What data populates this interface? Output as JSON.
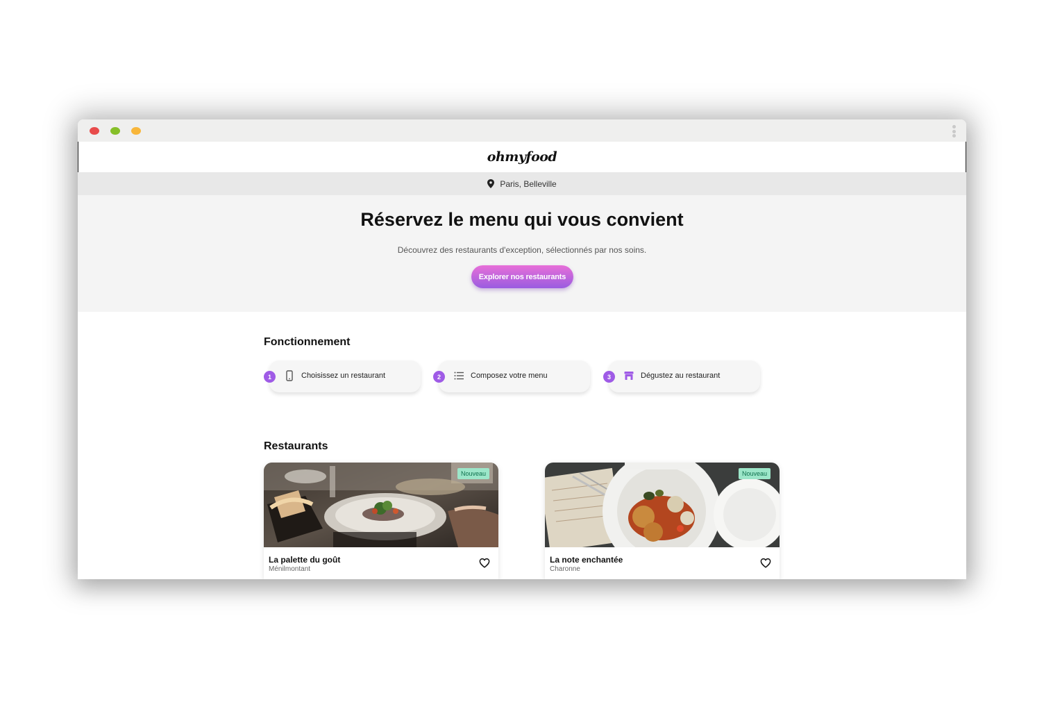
{
  "app": {
    "logo": "ohmyfood",
    "location": "Paris, Belleville"
  },
  "hero": {
    "title": "Réservez le menu qui vous convient",
    "subtitle": "Découvrez des restaurants d'exception, sélectionnés par nos soins.",
    "cta_label": "Explorer nos restaurants"
  },
  "how_it_works": {
    "title": "Fonctionnement",
    "steps": [
      {
        "number": "1",
        "label": "Choisissez un restaurant",
        "icon": "mobile-phone-icon"
      },
      {
        "number": "2",
        "label": "Composez votre menu",
        "icon": "list-icon"
      },
      {
        "number": "3",
        "label": "Dégustez au restaurant",
        "icon": "storefront-icon"
      }
    ]
  },
  "restaurants": {
    "title": "Restaurants",
    "items": [
      {
        "name": "La palette du goût",
        "location": "Ménilmontant",
        "badge": "Nouveau",
        "favorite_icon": "heart-outline-icon"
      },
      {
        "name": "La note enchantée",
        "location": "Charonne",
        "badge": "Nouveau",
        "favorite_icon": "heart-outline-icon"
      }
    ]
  },
  "colors": {
    "accent_purple": "#9f5be6",
    "accent_pink": "#e76fd8",
    "badge_green": "#9ce6c9",
    "window_close": "#e84b4b",
    "window_maximize": "#86bf28",
    "window_minimize": "#f8b63a"
  }
}
